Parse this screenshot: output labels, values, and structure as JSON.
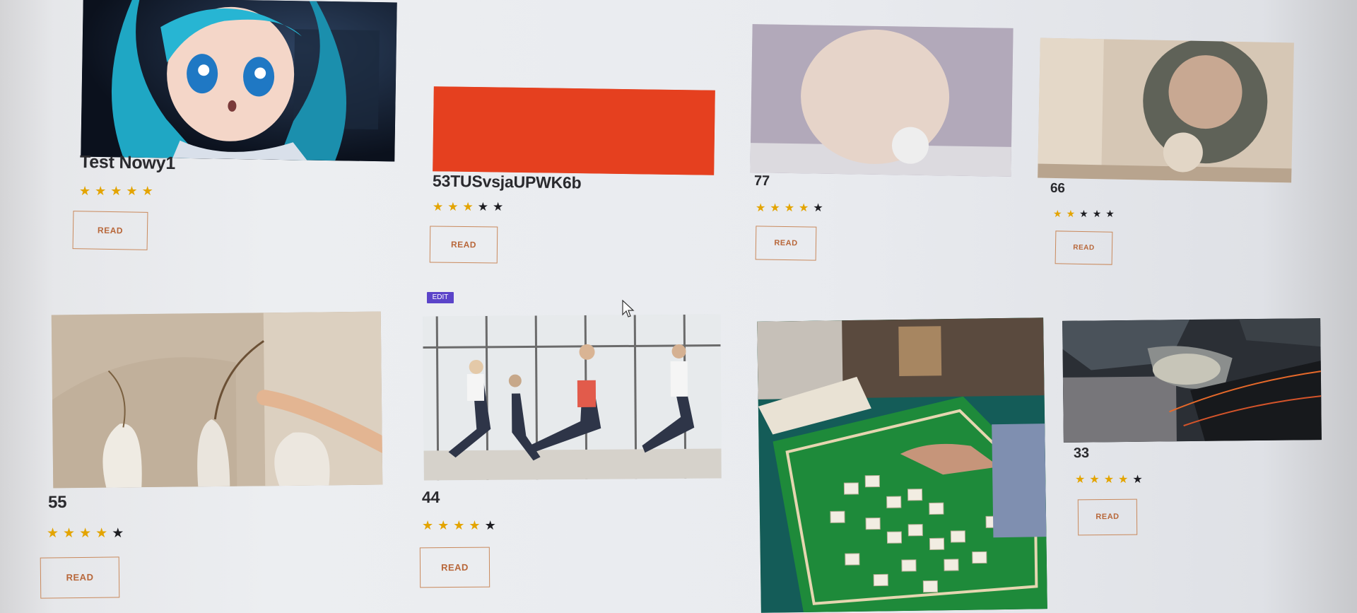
{
  "edit_label": "EDIT",
  "colors": {
    "star_on": "#e3a400",
    "star_off": "#1d1d22",
    "read_border": "#c9895c",
    "edit_bg": "#5b44c9"
  },
  "cards": [
    {
      "title": "Test Nowy1",
      "rating": 5,
      "max_rating": 5,
      "button": "READ",
      "image": "anime-girl-blue-hair"
    },
    {
      "title": "53TUSvsjaUPWK6b",
      "rating": 3,
      "max_rating": 5,
      "button": "READ",
      "image": "orange-red-block"
    },
    {
      "title": "77",
      "rating": 4,
      "max_rating": 5,
      "button": "READ",
      "image": "sphere-and-arch-still-life"
    },
    {
      "title": "66",
      "rating": 2,
      "max_rating": 5,
      "button": "READ",
      "image": "stone-ring-and-ball"
    },
    {
      "title": "55",
      "rating": 4,
      "max_rating": 5,
      "button": "READ",
      "image": "ceramic-vases-dried-flowers"
    },
    {
      "title": "44",
      "rating": 4,
      "max_rating": 5,
      "button": "READ",
      "image": "women-exercising-lunges"
    },
    {
      "title": "",
      "rating": 0,
      "max_rating": 0,
      "button": "",
      "image": "mahjong-table"
    },
    {
      "title": "33",
      "rating": 4,
      "max_rating": 5,
      "button": "READ",
      "image": "damaged-car-headlight"
    }
  ]
}
